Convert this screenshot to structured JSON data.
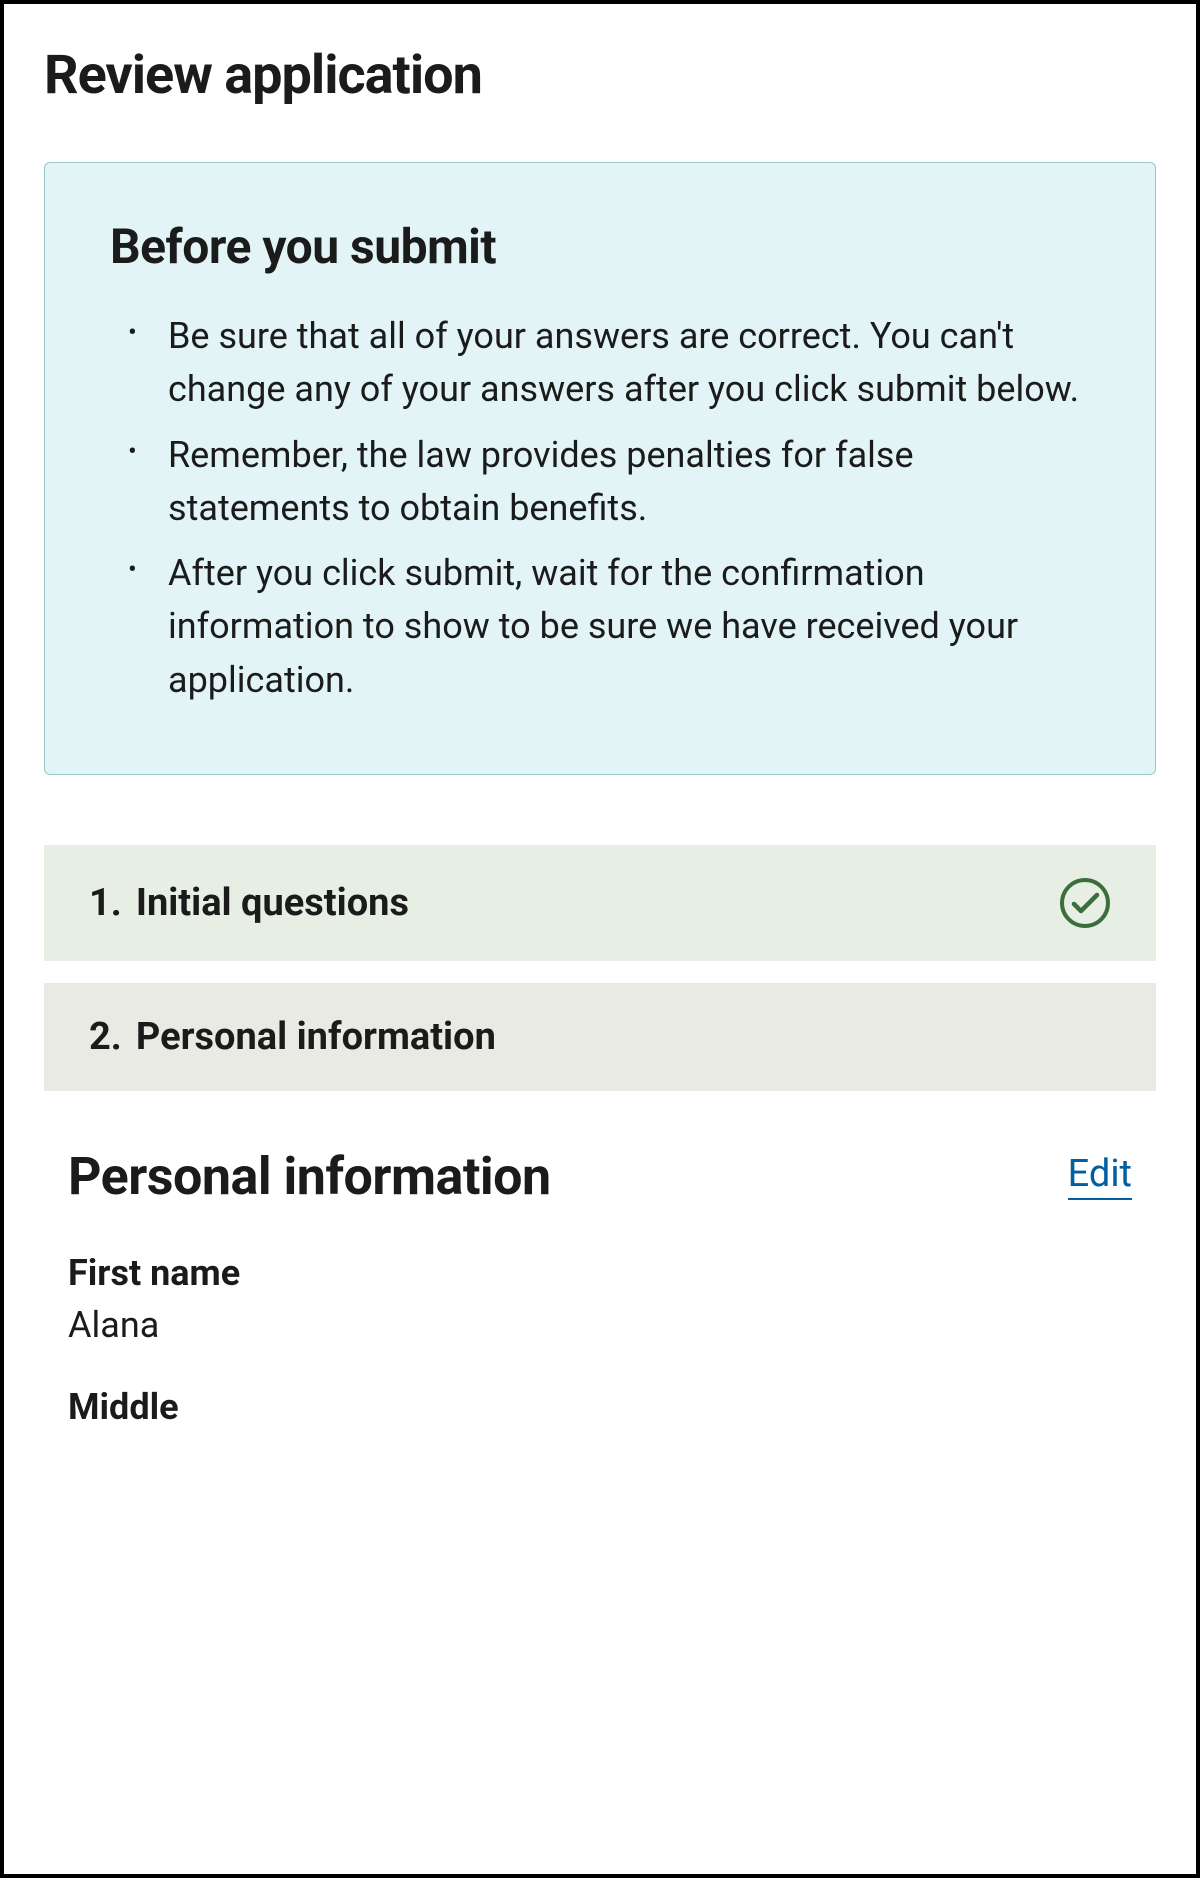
{
  "page": {
    "title": "Review application"
  },
  "infoBox": {
    "title": "Before you submit",
    "items": [
      "Be sure that all of your answers are correct. You can't change any of your answers after you click submit below.",
      "Remember, the law provides penalties for false statements to obtain benefits.",
      "After you click submit, wait for the confirmation information to show to be sure we have received your application."
    ]
  },
  "sections": [
    {
      "number": "1.",
      "label": "Initial questions",
      "completed": true
    },
    {
      "number": "2.",
      "label": "Personal information",
      "completed": false
    }
  ],
  "detail": {
    "title": "Personal information",
    "editLabel": "Edit",
    "fields": [
      {
        "label": "First name",
        "value": "Alana"
      },
      {
        "label": "Middle",
        "value": ""
      }
    ]
  }
}
